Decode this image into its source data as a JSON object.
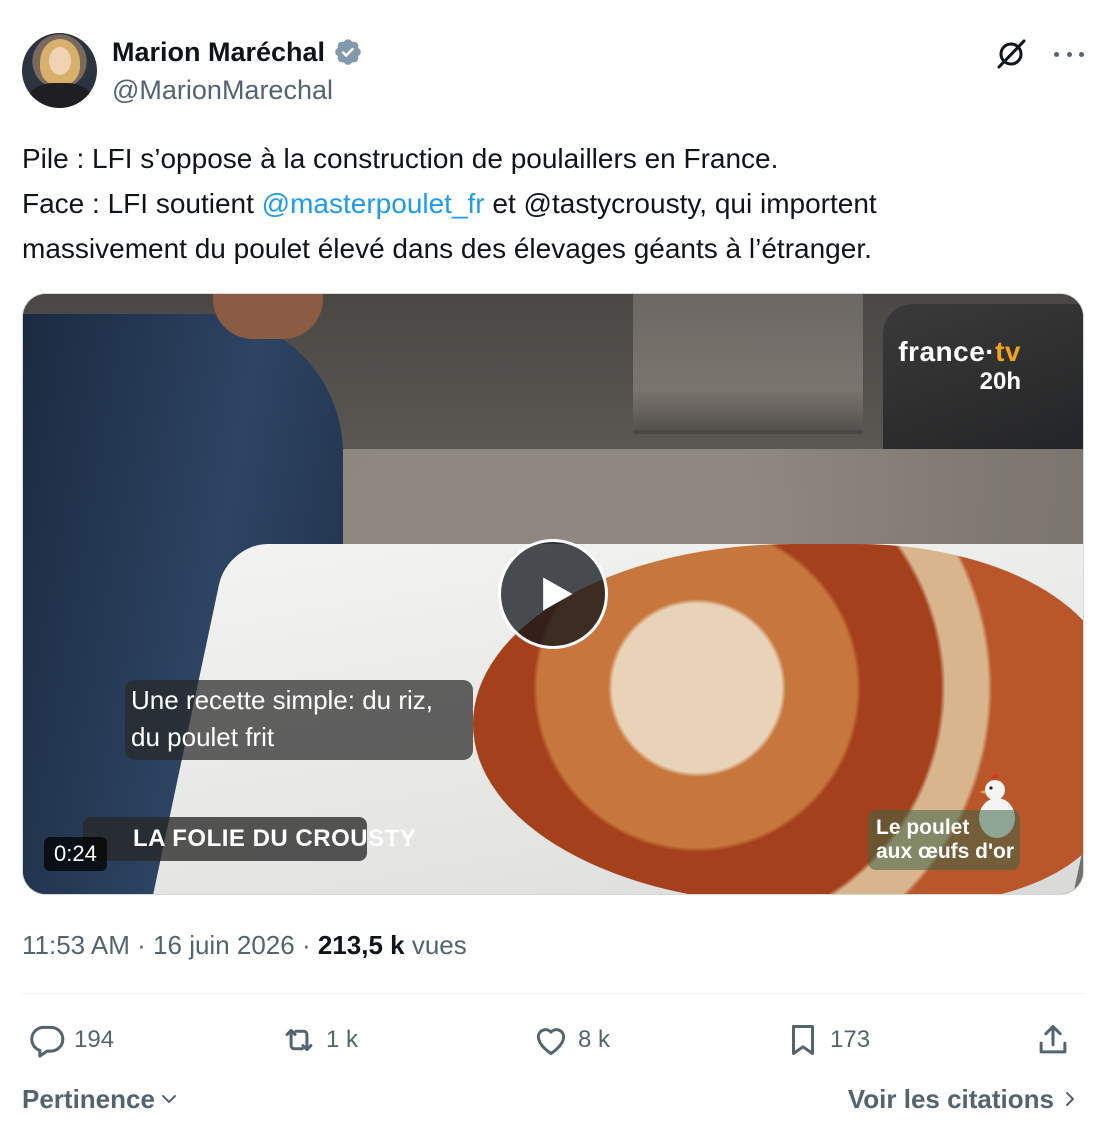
{
  "author": {
    "display_name": "Marion Maréchal",
    "handle": "@MarionMarechal",
    "verified": true,
    "verified_color": "#1d9bf0"
  },
  "header_icons": [
    "grok-icon",
    "more-icon"
  ],
  "tweet": {
    "line1": "Pile : LFI s’oppose à la construction de poulaillers en France.",
    "line2_prefix": "Face : LFI soutient ",
    "line2_mention": "@masterpoulet_fr",
    "line2_suffix": " et @tastycrousty, qui importent",
    "line3": "massivement du poulet élevé dans des élevages géants à l’étranger.",
    "mention_color": "#1d9bf0"
  },
  "media": {
    "type": "video",
    "duration": "0:24",
    "brand_name_part1": "france",
    "brand_name_dot": "·",
    "brand_name_part2": "tv",
    "brand_sub": "20h",
    "caption_line1": "Une recette simple: du riz,",
    "caption_line2": "du poulet frit",
    "banner_label": "LA FOLIE DU CROUSTY",
    "corner_label_line1": "Le poulet",
    "corner_label_line2": "aux œufs d'or"
  },
  "meta": {
    "time": "11:53 AM",
    "separator": " · ",
    "date": "16 juin 2026",
    "views_count": "213,5 k",
    "views_label": " vues"
  },
  "actions": {
    "replies": "194",
    "reposts": "1 k",
    "likes": "8 k",
    "bookmarks": "173"
  },
  "footer": {
    "sort_label": "Pertinence",
    "quotes_label": "Voir les citations"
  },
  "colors": {
    "text_primary": "#0f1419",
    "text_secondary": "#536471",
    "accent": "#1d9bf0"
  }
}
